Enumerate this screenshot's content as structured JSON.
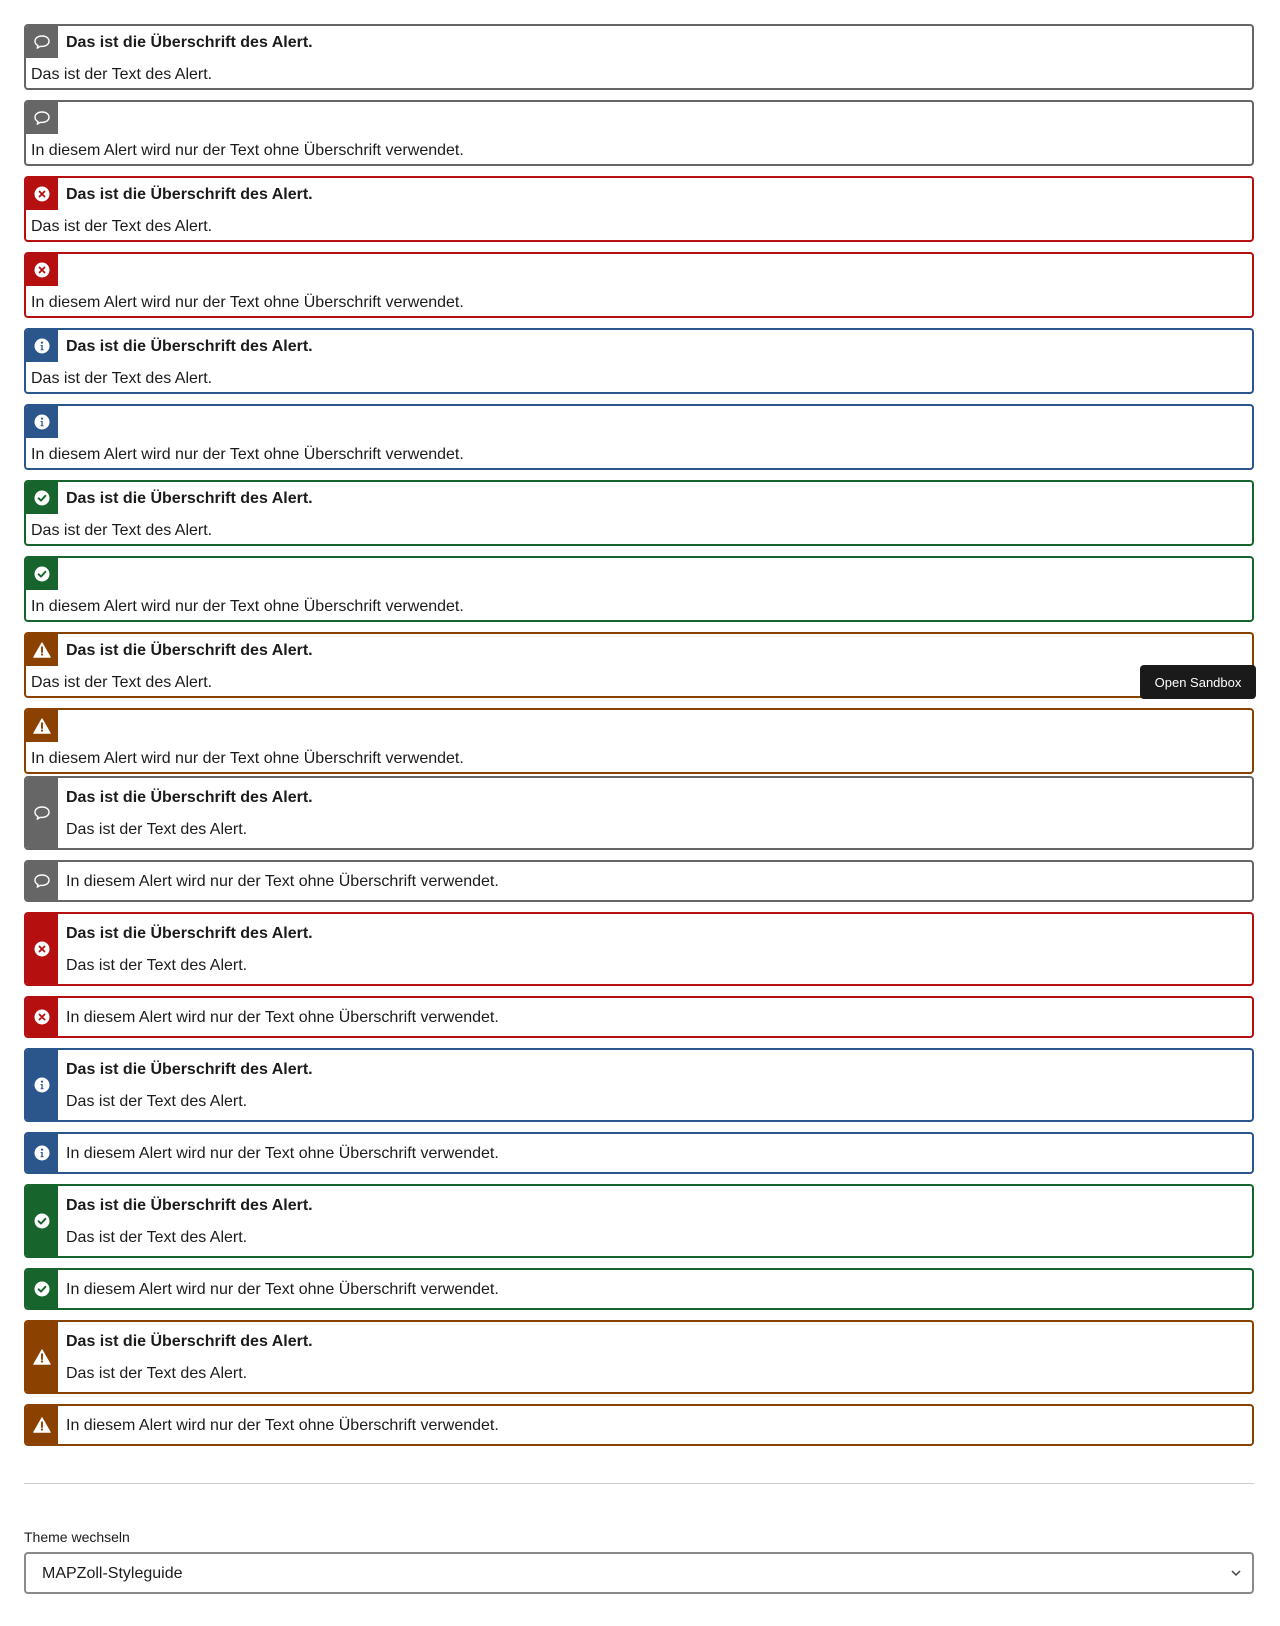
{
  "alert_title": "Das ist die Überschrift des Alert.",
  "alert_text": "Das ist der Text des Alert.",
  "alert_text_only": "In diesem Alert wird nur der Text ohne Überschrift verwendet.",
  "colors": {
    "neutral": "#666666",
    "error": "#b50f10",
    "info": "#2a568c",
    "success": "#17652c",
    "warning": "#8b4200"
  },
  "alerts": [
    {
      "type": "neutral",
      "icon": "chat-bubble-icon",
      "has_title": true
    },
    {
      "type": "neutral",
      "icon": "chat-bubble-icon",
      "has_title": false
    },
    {
      "type": "error",
      "icon": "error-x-icon",
      "has_title": true
    },
    {
      "type": "error",
      "icon": "error-x-icon",
      "has_title": false
    },
    {
      "type": "info",
      "icon": "info-icon",
      "has_title": true
    },
    {
      "type": "info",
      "icon": "info-icon",
      "has_title": false
    },
    {
      "type": "success",
      "icon": "check-circle-icon",
      "has_title": true
    },
    {
      "type": "success",
      "icon": "check-circle-icon",
      "has_title": false
    },
    {
      "type": "warning",
      "icon": "warning-triangle-icon",
      "has_title": true
    },
    {
      "type": "warning",
      "icon": "warning-triangle-icon",
      "has_title": false
    },
    {
      "type": "neutral",
      "icon": "chat-bubble-icon",
      "has_title": true
    },
    {
      "type": "neutral",
      "icon": "chat-bubble-icon",
      "has_title": false
    },
    {
      "type": "error",
      "icon": "error-x-icon",
      "has_title": true
    },
    {
      "type": "error",
      "icon": "error-x-icon",
      "has_title": false
    },
    {
      "type": "info",
      "icon": "info-icon",
      "has_title": true
    },
    {
      "type": "info",
      "icon": "info-icon",
      "has_title": false
    },
    {
      "type": "success",
      "icon": "check-circle-icon",
      "has_title": true
    },
    {
      "type": "success",
      "icon": "check-circle-icon",
      "has_title": false
    },
    {
      "type": "warning",
      "icon": "warning-triangle-icon",
      "has_title": true
    },
    {
      "type": "warning",
      "icon": "warning-triangle-icon",
      "has_title": false
    }
  ],
  "tooltip": {
    "label": "Open Sandbox"
  },
  "theme": {
    "label": "Theme wechseln",
    "selected": "MAPZoll-Styleguide"
  }
}
